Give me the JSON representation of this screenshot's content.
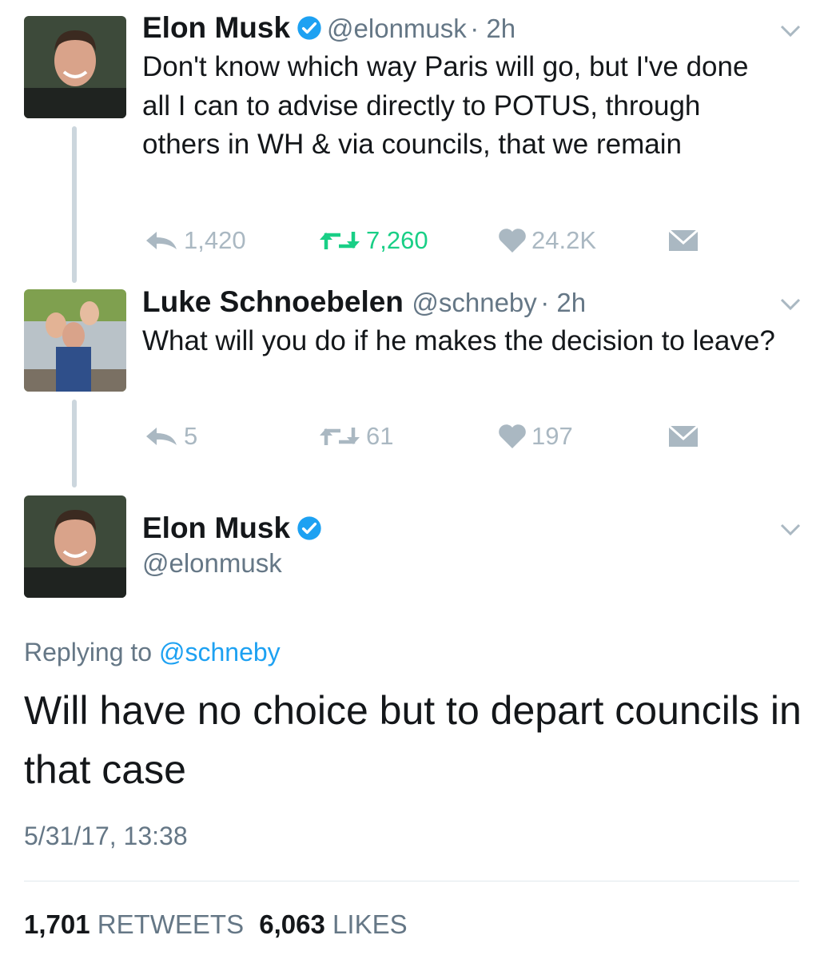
{
  "tweets": [
    {
      "name": "Elon Musk",
      "handle": "@elonmusk",
      "time": "· 2h",
      "text": "Don't know which way Paris will go, but I've done all I can to advise directly to POTUS, through others in WH & via councils, that we remain",
      "replies": "1,420",
      "retweets": "7,260",
      "likes": "24.2K"
    },
    {
      "name": "Luke Schnoebelen",
      "handle": "@schneby",
      "time": "· 2h",
      "text": "What will you do if he makes the decision to leave?",
      "replies": "5",
      "retweets": "61",
      "likes": "197"
    }
  ],
  "main": {
    "name": "Elon Musk",
    "handle": "@elonmusk",
    "replying_prefix": "Replying to",
    "replying_to": "@schneby",
    "text": "Will have no choice but to depart councils in that case",
    "timestamp": "5/31/17, 13:38",
    "retweet_count": "1,701",
    "retweet_label": "RETWEETS",
    "like_count": "6,063",
    "like_label": "LIKES"
  },
  "colors": {
    "verified": "#1da1f2",
    "retweet_active": "#19cf86",
    "action_gray": "#aab8c2"
  }
}
